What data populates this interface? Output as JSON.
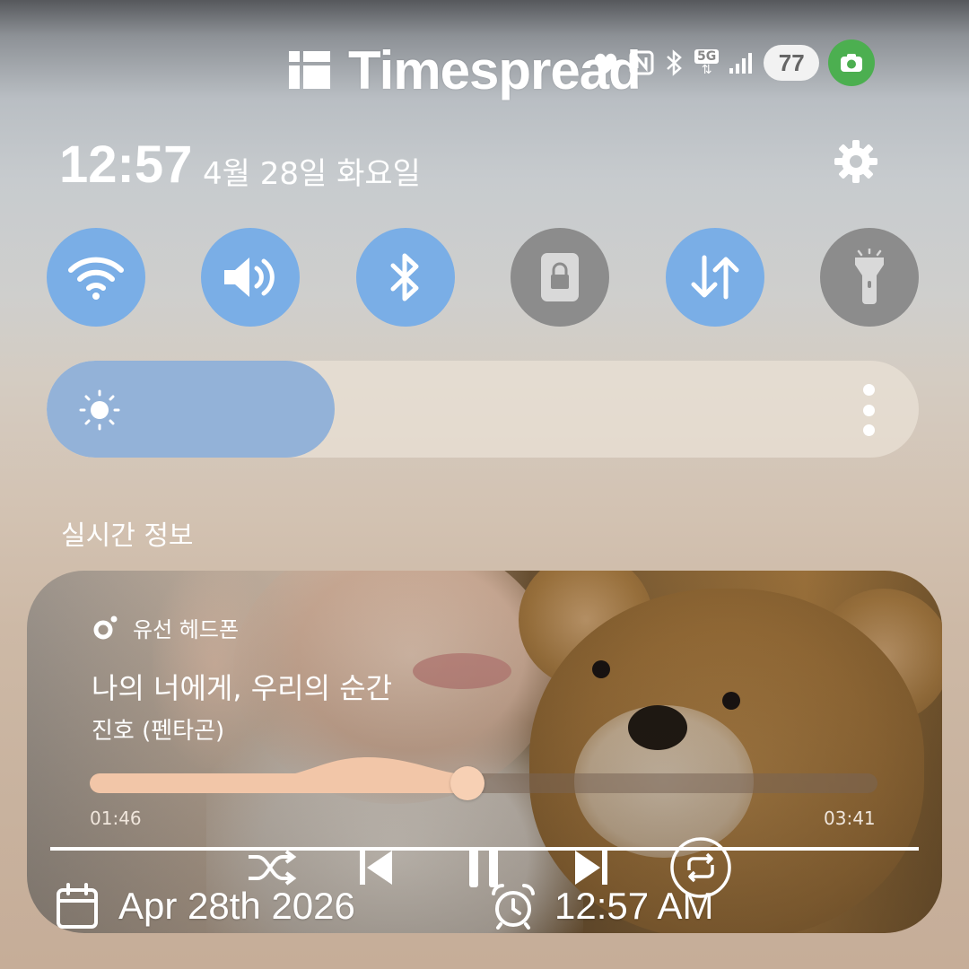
{
  "watermark": {
    "brand": "Timespread"
  },
  "status_bar": {
    "network_label": "5G",
    "battery_level": "77",
    "icons": [
      "heart-icon",
      "nfc-icon",
      "bluetooth-icon",
      "5g-icon",
      "signal-icon",
      "battery-icon",
      "camera-icon"
    ]
  },
  "header": {
    "time": "12:57",
    "date": "4월 28일 화요일",
    "settings_icon": "gear-icon"
  },
  "quick_toggles": [
    {
      "icon": "wifi-icon",
      "state": "on"
    },
    {
      "icon": "sound-icon",
      "state": "on"
    },
    {
      "icon": "bluetooth-icon",
      "state": "on"
    },
    {
      "icon": "screen-lock-icon",
      "state": "off"
    },
    {
      "icon": "mobile-data-icon",
      "state": "on"
    },
    {
      "icon": "flashlight-icon",
      "state": "off"
    }
  ],
  "brightness": {
    "level": 0.33,
    "icon": "sun-icon"
  },
  "section": {
    "label": "실시간 정보"
  },
  "media": {
    "source": "유선 헤드폰",
    "title": "나의 너에게, 우리의 순간",
    "artist": "진호 (펜타곤)",
    "elapsed": "01:46",
    "total": "03:41",
    "progress": 0.48,
    "controls": [
      "shuffle-icon",
      "previous-icon",
      "pause-icon",
      "next-icon",
      "repeat-icon"
    ]
  },
  "overlay": {
    "date": "Apr 28th 2026",
    "time": "12:57 AM"
  },
  "colors": {
    "toggle_on": "#7aaee6",
    "toggle_off": "#8c8c8c",
    "brightness_fill": "#93b2d8",
    "seek_fill": "#f2c6a8",
    "camera_dot": "#4caf50"
  }
}
